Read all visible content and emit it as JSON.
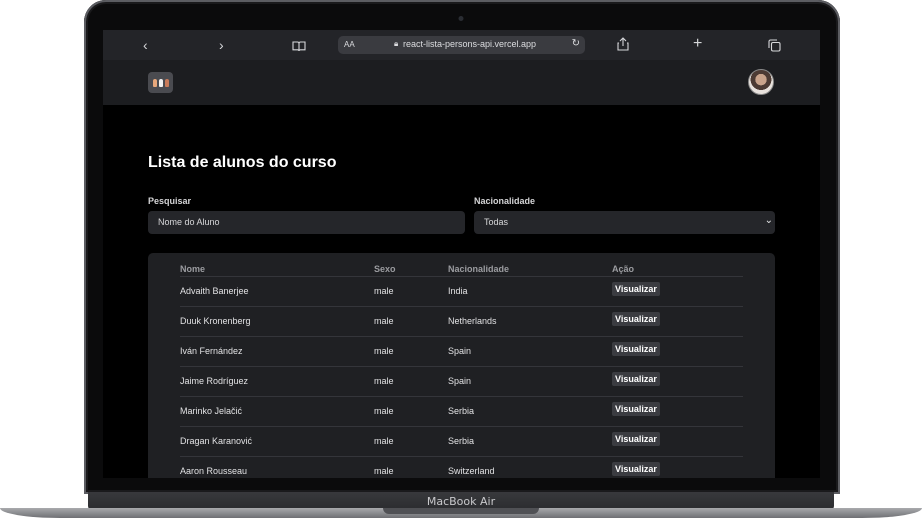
{
  "device": {
    "label": "MacBook Air"
  },
  "browser": {
    "back_icon": "‹",
    "forward_icon": "›",
    "bookmarks_icon": "book-icon",
    "text_size_label": "AA",
    "url": "react-lista-persons-api.vercel.app",
    "share_icon": "share-icon",
    "new_tab_icon": "+",
    "tabs_icon": "tabs-icon"
  },
  "page": {
    "title": "Lista de alunos do curso",
    "search": {
      "label": "Pesquisar",
      "placeholder": "Nome do Aluno"
    },
    "nationality": {
      "label": "Nacionalidade",
      "selected": "Todas"
    },
    "table": {
      "columns": [
        "Nome",
        "Sexo",
        "Nacionalidade",
        "Ação"
      ],
      "action_label": "Visualizar",
      "rows": [
        [
          "Advaith Banerjee",
          "male",
          "India"
        ],
        [
          "Duuk Kronenberg",
          "male",
          "Netherlands"
        ],
        [
          "Iván Fernández",
          "male",
          "Spain"
        ],
        [
          "Jaime Rodríguez",
          "male",
          "Spain"
        ],
        [
          "Marinko Jelačić",
          "male",
          "Serbia"
        ],
        [
          "Dragan Karanović",
          "male",
          "Serbia"
        ],
        [
          "Aaron Rousseau",
          "male",
          "Switzerland"
        ]
      ]
    }
  },
  "colors": {
    "background": "#000000",
    "card": "#1f2023",
    "header": "#1c1d20"
  }
}
